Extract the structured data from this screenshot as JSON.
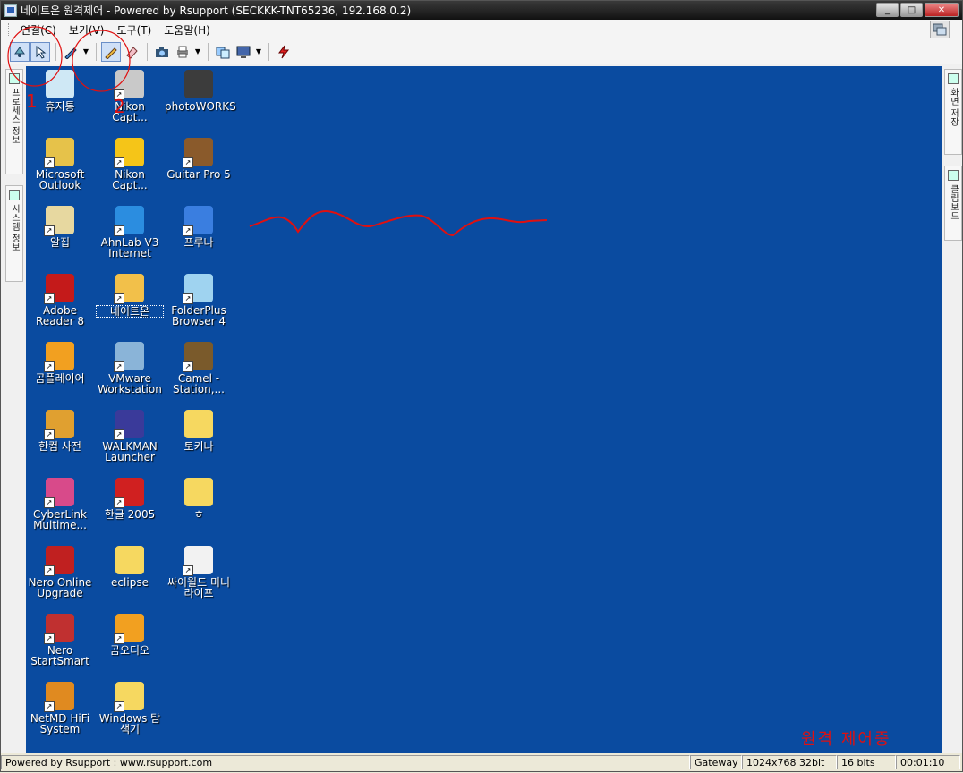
{
  "window": {
    "title": "네이트온 원격제어 - Powered by Rsupport (SECKKK-TNT65236, 192.168.0.2)",
    "minimize": "_",
    "maximize": "□",
    "close": "✕"
  },
  "menu": [
    {
      "label": "연결(C)"
    },
    {
      "label": "보기(V)"
    },
    {
      "label": "도구(T)"
    },
    {
      "label": "도움말(H)"
    }
  ],
  "toolbar": {
    "icons": [
      "remote-control-icon",
      "pointer-icon",
      "pen-icon",
      "dropdown-icon",
      "pencil-icon",
      "eraser-icon",
      "camera-icon",
      "print-icon",
      "dropdown-icon",
      "transfer-icon",
      "screen-icon",
      "dropdown-icon",
      "disconnect-icon"
    ]
  },
  "left_tabs": [
    {
      "label": "프로세스 정보"
    },
    {
      "label": "시스템 정보"
    }
  ],
  "right_tabs": [
    {
      "label": "화면 저장"
    },
    {
      "label": "클립보드"
    }
  ],
  "desktop": {
    "background": "#0a4ba0",
    "icons": [
      {
        "label": "휴지통",
        "color": "#cfe8f5",
        "arrow": false
      },
      {
        "label": "Nikon Capt...",
        "color": "#c9c9c9",
        "arrow": true
      },
      {
        "label": "photoWORKS",
        "color": "#3c3c3c",
        "arrow": false
      },
      {
        "label": "Microsoft Outlook",
        "color": "#e6c24a",
        "arrow": true
      },
      {
        "label": "Nikon Capt...",
        "color": "#f5c518",
        "arrow": true
      },
      {
        "label": "Guitar Pro 5",
        "color": "#8a5a2b",
        "arrow": true
      },
      {
        "label": "알집",
        "color": "#e7d8a0",
        "arrow": true
      },
      {
        "label": "AhnLab V3 Internet",
        "color": "#2b8de0",
        "arrow": true
      },
      {
        "label": "프루나",
        "color": "#3a7ee0",
        "arrow": true
      },
      {
        "label": "Adobe Reader 8",
        "color": "#c41a1a",
        "arrow": true
      },
      {
        "label": "네이트온",
        "color": "#f2c04a",
        "arrow": true
      },
      {
        "label": "FolderPlus Browser 4",
        "color": "#9fd3f0",
        "arrow": true
      },
      {
        "label": "곰플레이어",
        "color": "#f2a020",
        "arrow": true
      },
      {
        "label": "VMware Workstation",
        "color": "#8ab4d8",
        "arrow": true
      },
      {
        "label": "Camel - Station,...",
        "color": "#7a5a2b",
        "arrow": true
      },
      {
        "label": "한컴 사전",
        "color": "#e0a030",
        "arrow": true
      },
      {
        "label": "WALKMAN Launcher",
        "color": "#3a3a9a",
        "arrow": true
      },
      {
        "label": "토키나",
        "color": "#f6d860",
        "arrow": false
      },
      {
        "label": "CyberLink Multime...",
        "color": "#d84a8a",
        "arrow": true
      },
      {
        "label": "한글 2005",
        "color": "#d02020",
        "arrow": true
      },
      {
        "label": "ㅎ",
        "color": "#f6d860",
        "arrow": false
      },
      {
        "label": "Nero Online Upgrade",
        "color": "#c02020",
        "arrow": true
      },
      {
        "label": "eclipse",
        "color": "#f6d860",
        "arrow": false
      },
      {
        "label": "싸이월드 미니라이프",
        "color": "#f2f2f2",
        "arrow": true
      },
      {
        "label": "Nero StartSmart",
        "color": "#c03030",
        "arrow": true
      },
      {
        "label": "곰오디오",
        "color": "#f2a020",
        "arrow": true
      },
      {
        "label": "NetMD HiFi System",
        "color": "#e08a20",
        "arrow": true
      },
      {
        "label": "Windows 탐색기",
        "color": "#f6d860",
        "arrow": true
      }
    ]
  },
  "annotations": {
    "num1": "1",
    "num2": "2",
    "remote_status": "원격 제어중"
  },
  "status": [
    {
      "label": "Powered by Rsupport : www.rsupport.com"
    },
    {
      "label": "Gateway"
    },
    {
      "label": "1024x768 32bit"
    },
    {
      "label": "16 bits"
    },
    {
      "label": "00:01:10"
    }
  ]
}
